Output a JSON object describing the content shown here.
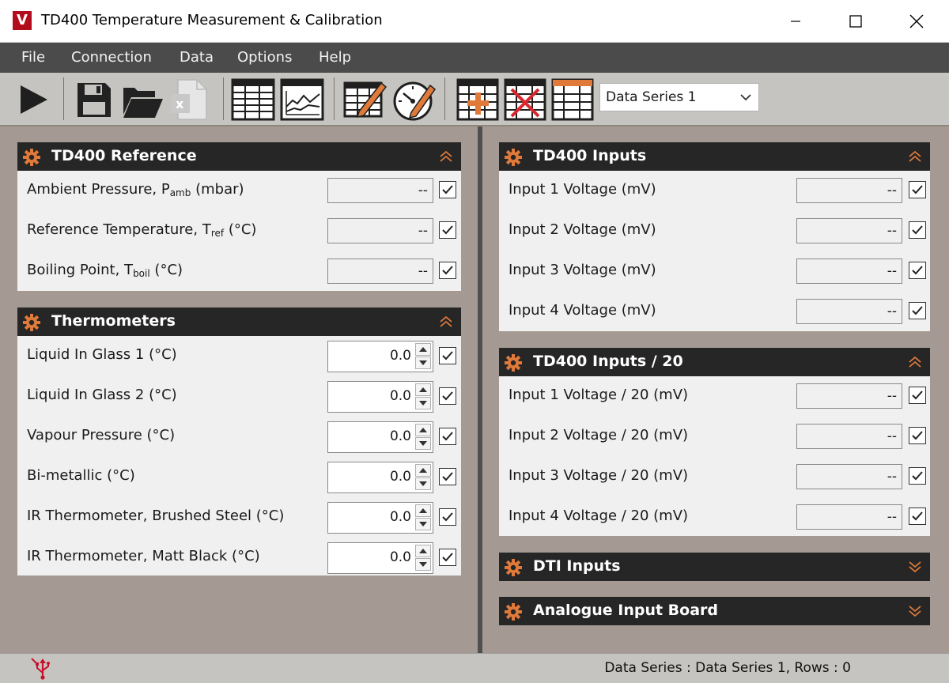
{
  "window": {
    "title": "TD400 Temperature Measurement & Calibration",
    "logo_letter": "V"
  },
  "menu": [
    "File",
    "Connection",
    "Data",
    "Options",
    "Help"
  ],
  "toolbar": {
    "data_series_selected": "Data Series 1"
  },
  "reference_panel": {
    "title": "TD400 Reference",
    "rows": [
      {
        "label_main": "Ambient Pressure, P",
        "label_sub": "amb",
        "label_unit": " (mbar)",
        "value": "--",
        "checked": true
      },
      {
        "label_main": "Reference Temperature, T",
        "label_sub": "ref",
        "label_unit": " (°C)",
        "value": "--",
        "checked": true
      },
      {
        "label_main": "Boiling Point, T",
        "label_sub": "boil",
        "label_unit": "  (°C)",
        "value": "--",
        "checked": true
      }
    ]
  },
  "thermometers_panel": {
    "title": "Thermometers",
    "rows": [
      {
        "label": "Liquid In Glass 1  (°C)",
        "value": "0.0",
        "checked": true
      },
      {
        "label": "Liquid In Glass 2  (°C)",
        "value": "0.0",
        "checked": true
      },
      {
        "label": "Vapour Pressure (°C)",
        "value": "0.0",
        "checked": true
      },
      {
        "label": "Bi-metallic  (°C)",
        "value": "0.0",
        "checked": true
      },
      {
        "label": "IR Thermometer, Brushed Steel  (°C)",
        "value": "0.0",
        "checked": true
      },
      {
        "label": "IR Thermometer, Matt Black  (°C)",
        "value": "0.0",
        "checked": true
      }
    ]
  },
  "inputs_panel": {
    "title": "TD400 Inputs",
    "rows": [
      {
        "label": "Input 1 Voltage  (mV)",
        "value": "--",
        "checked": true
      },
      {
        "label": "Input 2 Voltage  (mV)",
        "value": "--",
        "checked": true
      },
      {
        "label": "Input 3 Voltage  (mV)",
        "value": "--",
        "checked": true
      },
      {
        "label": "Input 4 Voltage  (mV)",
        "value": "--",
        "checked": true
      }
    ]
  },
  "inputs20_panel": {
    "title": "TD400 Inputs / 20",
    "rows": [
      {
        "label": "Input 1 Voltage / 20 (mV)",
        "value": "--",
        "checked": true
      },
      {
        "label": "Input 2 Voltage / 20 (mV)",
        "value": "--",
        "checked": true
      },
      {
        "label": "Input 3 Voltage / 20 (mV)",
        "value": "--",
        "checked": true
      },
      {
        "label": "Input 4 Voltage / 20 (mV)",
        "value": "--",
        "checked": true
      }
    ]
  },
  "dti_panel": {
    "title": "DTI Inputs"
  },
  "analogue_panel": {
    "title": "Analogue Input Board"
  },
  "status": {
    "text": "Data Series : Data Series 1,  Rows : 0"
  },
  "colors": {
    "accent_orange": "#e07a3a",
    "header_dark": "#262626",
    "menubar": "#4b4b4b",
    "workspace": "#a59a93"
  }
}
